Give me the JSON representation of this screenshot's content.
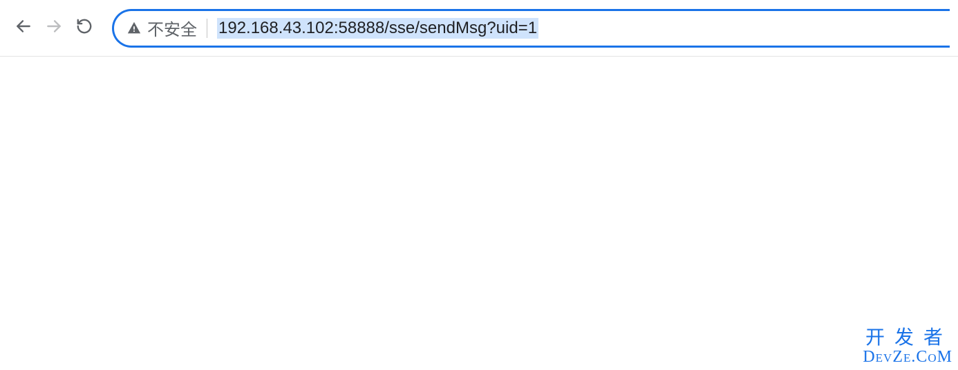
{
  "toolbar": {
    "security_label": "不安全",
    "url": "192.168.43.102:58888/sse/sendMsg?uid=1"
  },
  "watermark": {
    "line1": "开发者",
    "line2": "DevZe.CoM"
  },
  "colors": {
    "accent": "#1a73e8",
    "url_highlight_bg": "#cfe3fc",
    "icon_gray": "#5f6368",
    "disabled_gray": "#bcbdbf"
  }
}
